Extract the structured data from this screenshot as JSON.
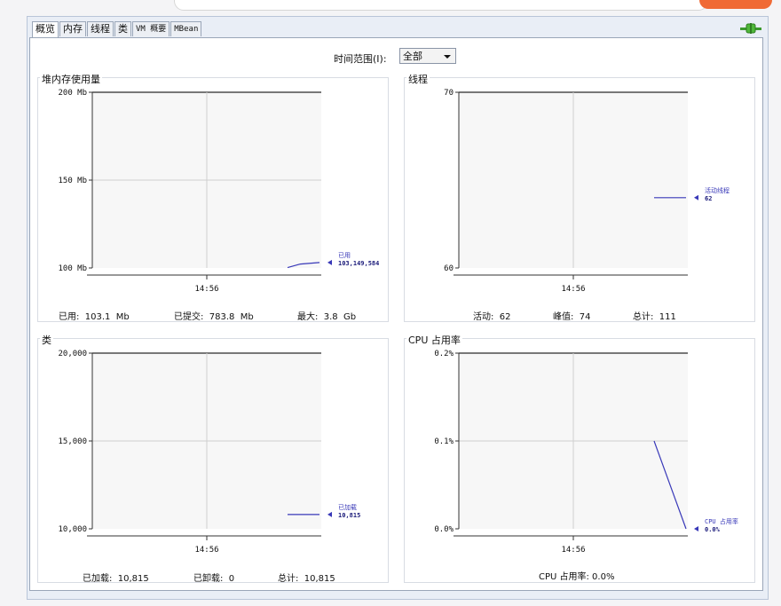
{
  "tabs": [
    "概览",
    "内存",
    "线程",
    "类",
    "VM 概要",
    "MBean"
  ],
  "time_range": {
    "label": "时间范围(I):",
    "value": "全部"
  },
  "colors": {
    "series": "#3838b8",
    "grid": "#cfcfcf",
    "axis": "#333333"
  },
  "icons": {
    "connect": "connect-plug-icon",
    "cursor": "mouse-pointer-icon"
  },
  "panels": {
    "heap": {
      "title": "堆内存使用量",
      "stats": [
        "已用:  103.1  Mb",
        "已提交:  783.8  Mb",
        "最大:  3.8  Gb"
      ]
    },
    "threads": {
      "title": "线程",
      "stats": [
        "活动:  62",
        "峰值:  74",
        "总计:  111"
      ]
    },
    "classes": {
      "title": "类",
      "stats": [
        "已加载:  10,815",
        "已卸载:  0",
        "总计:  10,815"
      ]
    },
    "cpu": {
      "title": "CPU 占用率",
      "stats": [
        "CPU 占用率: 0.0%"
      ]
    }
  },
  "chart_data": [
    {
      "id": "heap",
      "type": "line",
      "yticks": [
        "200 Mb",
        "150 Mb",
        "100 Mb"
      ],
      "ylim": [
        100,
        200
      ],
      "xtick": "14:56",
      "series": [
        {
          "name": "已用",
          "value_label": "103,149,584",
          "points": [
            [
              0.0,
              100.2
            ],
            [
              0.4,
              102.2
            ],
            [
              1.0,
              103.1
            ]
          ]
        }
      ]
    },
    {
      "id": "threads",
      "type": "line",
      "yticks": [
        "70",
        "60"
      ],
      "ylim": [
        60,
        70
      ],
      "xtick": "14:56",
      "series": [
        {
          "name": "活动线程",
          "value_label": "62",
          "points": [
            [
              0.0,
              64
            ],
            [
              1.0,
              64
            ]
          ]
        }
      ]
    },
    {
      "id": "classes",
      "type": "line",
      "yticks": [
        "20,000",
        "15,000",
        "10,000"
      ],
      "ylim": [
        10000,
        20000
      ],
      "xtick": "14:56",
      "series": [
        {
          "name": "已加载",
          "value_label": "10,815",
          "points": [
            [
              0.0,
              10815
            ],
            [
              1.0,
              10815
            ]
          ]
        }
      ]
    },
    {
      "id": "cpu",
      "type": "line",
      "yticks": [
        "0.2%",
        "0.1%",
        "0.0%"
      ],
      "ylim": [
        0.0,
        0.2
      ],
      "xtick": "14:56",
      "series": [
        {
          "name": "CPU 占用率",
          "value_label": "0.0%",
          "points": [
            [
              0.0,
              0.1
            ],
            [
              1.0,
              0.0
            ]
          ]
        }
      ]
    }
  ]
}
